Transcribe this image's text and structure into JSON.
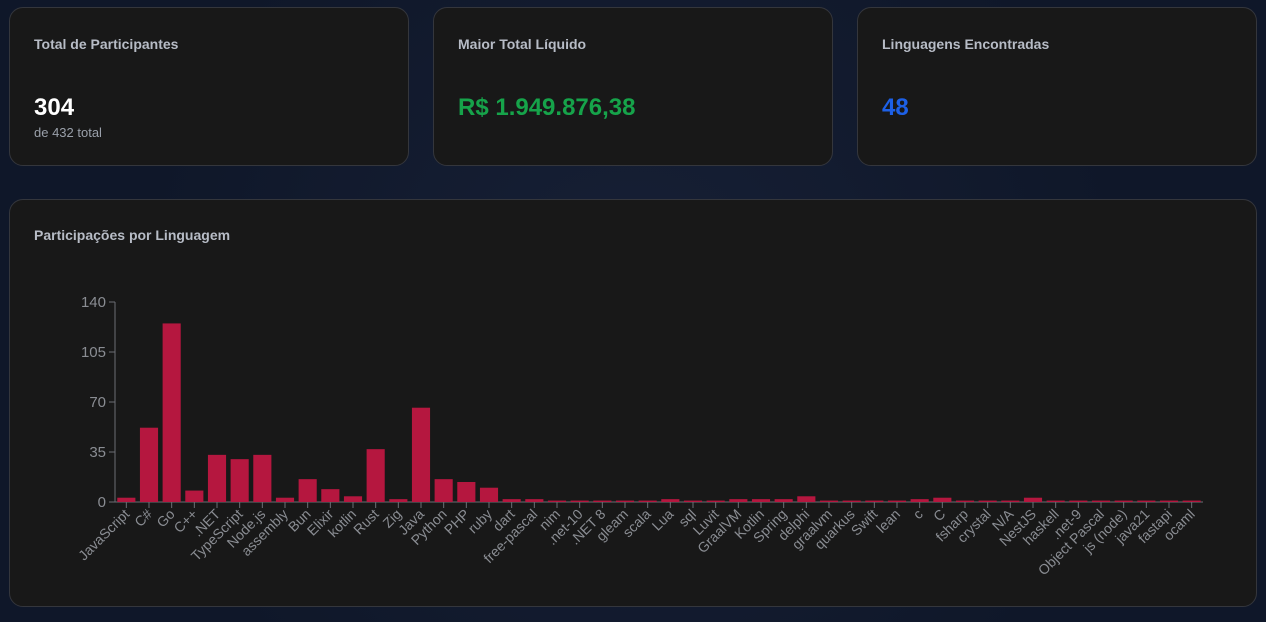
{
  "stats": [
    {
      "label": "Total de Participantes",
      "value": "304",
      "sub": "de 432 total"
    },
    {
      "label": "Maior Total Líquido",
      "value": "R$ 1.949.876,38"
    },
    {
      "label": "Linguagens Encontradas",
      "value": "48"
    }
  ],
  "chart_card": {
    "title": "Participações por Linguagem"
  },
  "colors": {
    "bar": "#b5173f",
    "axis": "#6b6e75",
    "tick_text": "#8a8d93",
    "green": "#16a34a",
    "blue": "#1d60e6"
  },
  "chart_data": {
    "type": "bar",
    "title": "Participações por Linguagem",
    "xlabel": "",
    "ylabel": "",
    "ylim": [
      0,
      140
    ],
    "yticks": [
      0,
      35,
      70,
      105,
      140
    ],
    "grid": false,
    "categories": [
      "JavaScript",
      "C#",
      "Go",
      "C++",
      ".NET",
      "TypeScript",
      "Node.js",
      "assembly",
      "Bun",
      "Elixir",
      "kotlin",
      "Rust",
      "Zig",
      "Java",
      "Python",
      "PHP",
      "ruby",
      "dart",
      "free-pascal",
      "nim",
      ".net-10",
      ".NET 8",
      "gleam",
      "scala",
      "Lua",
      "sql",
      "Luvit",
      "GraalVM",
      "Kotlin",
      "Spring",
      "delphi",
      "graalvm",
      "quarkus",
      "Swift",
      "lean",
      "c",
      "C",
      "fsharp",
      "crystal",
      "N/A",
      "NestJS",
      "haskell",
      ".net-9",
      "Object Pascal",
      "js (node)",
      "java21",
      "fastapi",
      "ocaml"
    ],
    "values": [
      3,
      52,
      125,
      8,
      33,
      30,
      33,
      3,
      16,
      9,
      4,
      37,
      2,
      66,
      16,
      14,
      10,
      2,
      2,
      1,
      1,
      1,
      1,
      1,
      2,
      1,
      1,
      2,
      2,
      2,
      4,
      1,
      1,
      1,
      1,
      2,
      3,
      1,
      1,
      1,
      3,
      1,
      1,
      1,
      1,
      1,
      1,
      1
    ]
  }
}
